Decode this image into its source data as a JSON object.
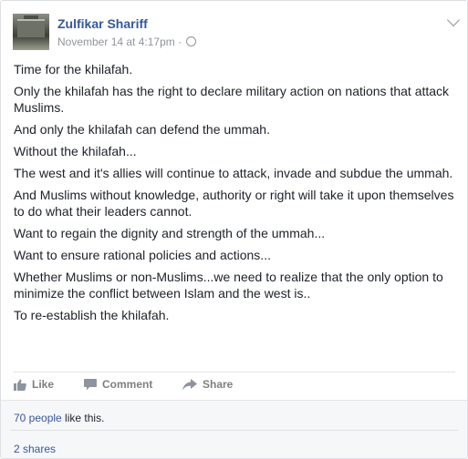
{
  "post": {
    "author": "Zulfikar Shariff",
    "timestamp": "November 14 at 4:17pm",
    "separator": "·",
    "privacy_icon": "globe-icon",
    "menu_icon": "chevron-down-icon",
    "paragraphs": [
      "Time for the khilafah.",
      "Only the khilafah has the right to declare military action on nations that attack Muslims.",
      "And only the khilafah can defend the ummah.",
      "Without the khilafah...",
      "The west and it's allies will continue to attack, invade and subdue the ummah.",
      "And Muslims without knowledge, authority or right will take it upon themselves to do what their leaders cannot.",
      "Want to regain the dignity and strength of the ummah...",
      "Want to ensure rational policies and actions...",
      "Whether Muslims or non-Muslims...we need to realize that the only option to minimize the conflict between Islam and the west is..",
      "To re-establish the khilafah."
    ]
  },
  "actions": {
    "like": "Like",
    "comment": "Comment",
    "share": "Share"
  },
  "footer": {
    "likes_link": "70 people",
    "likes_suffix": " like this.",
    "shares": "2 shares"
  },
  "colors": {
    "link": "#365899",
    "text": "#1d2129",
    "muted": "#90949c",
    "footer_bg": "#f6f7f9"
  }
}
